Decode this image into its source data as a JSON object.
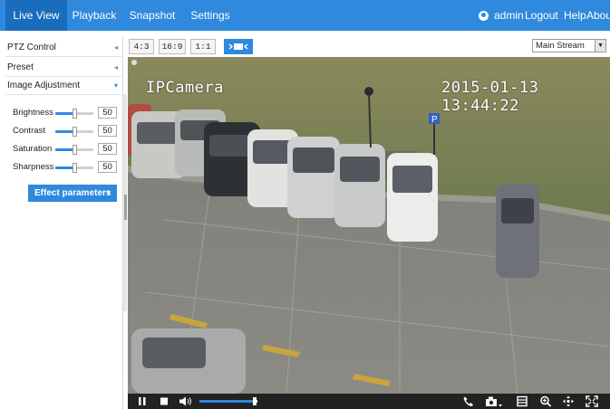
{
  "nav": {
    "items": [
      {
        "label": "Live View",
        "active": true
      },
      {
        "label": "Playback",
        "active": false
      },
      {
        "label": "Snapshot",
        "active": false
      },
      {
        "label": "Settings",
        "active": false
      }
    ],
    "username": "admin",
    "logout": "Logout",
    "help": "Help",
    "about": "About",
    "user_icon": "user-circle-icon"
  },
  "sidebar": {
    "sections": [
      {
        "label": "PTZ Control",
        "expanded": false
      },
      {
        "label": "Preset",
        "expanded": false
      },
      {
        "label": "Image Adjustment",
        "expanded": true
      }
    ],
    "adjustments": [
      {
        "label": "Brightness",
        "value": "50",
        "level": 0.5
      },
      {
        "label": "Contrast",
        "value": "50",
        "level": 0.5
      },
      {
        "label": "Saturation",
        "value": "50",
        "level": 0.5
      },
      {
        "label": "Sharpness",
        "value": "50",
        "level": 0.5
      }
    ],
    "effect_button": "Effect parameters"
  },
  "toolbar": {
    "ratios": [
      {
        "label": "4:3",
        "active": false
      },
      {
        "label": "16:9",
        "active": false
      },
      {
        "label": "1:1",
        "active": false
      }
    ],
    "fit_button_icon": "fit-window-icon",
    "stream": "Main Stream"
  },
  "video": {
    "camera_name": "IPCamera",
    "timestamp": "2015-01-13 13:44:22"
  },
  "controls": {
    "icons": [
      "pause-icon",
      "stop-icon",
      "volume-icon",
      "phone-icon",
      "snapshot-icon",
      "record-icon",
      "zoom-icon",
      "ptz-icon",
      "fullscreen-icon"
    ],
    "volume_level": 0.95
  },
  "colors": {
    "accent": "#2f89dd",
    "active_nav": "#1a6cbd",
    "control_bar": "#222222"
  }
}
